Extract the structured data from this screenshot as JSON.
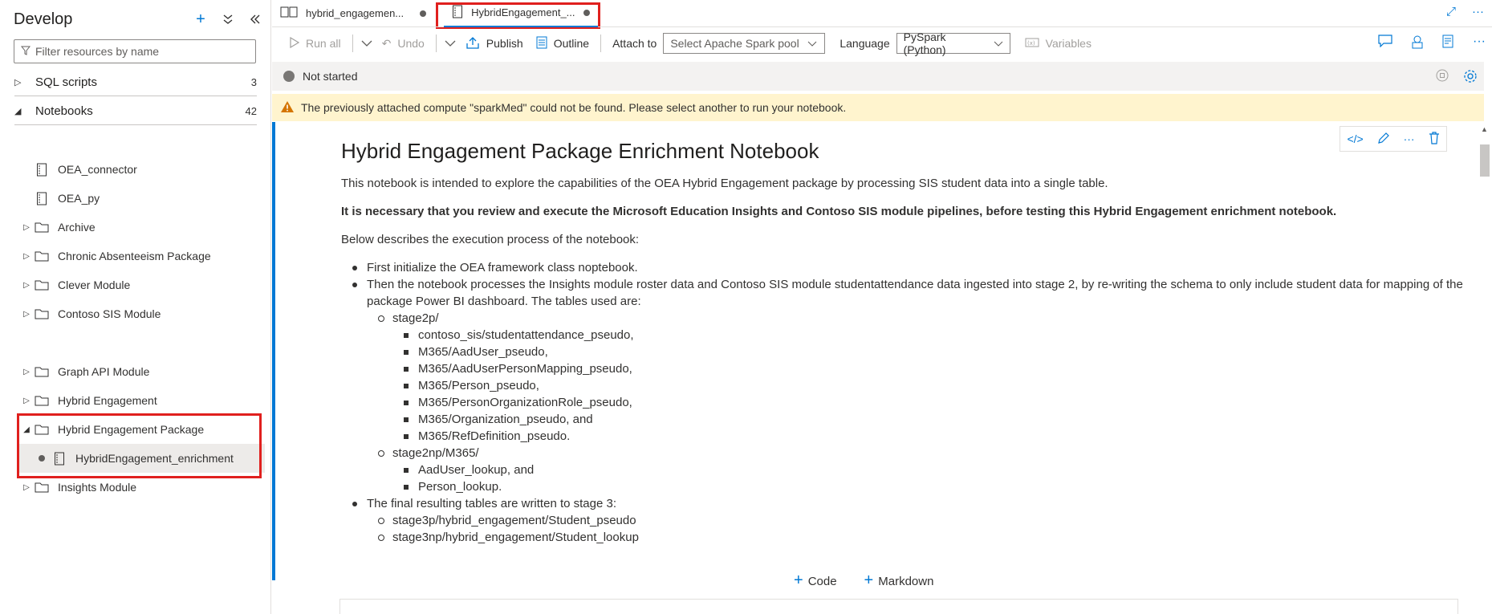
{
  "sidebar": {
    "title": "Develop",
    "filter_placeholder": "Filter resources by name",
    "sections": [
      {
        "label": "SQL scripts",
        "count": "3"
      },
      {
        "label": "Notebooks",
        "count": "42"
      }
    ],
    "items": {
      "oea_connector": "OEA_connector",
      "oea_py": "OEA_py",
      "archive": "Archive",
      "chronic": "Chronic Absenteeism Package",
      "clever": "Clever Module",
      "contoso": "Contoso SIS Module",
      "graph": "Graph API Module",
      "hybrid": "Hybrid Engagement",
      "hybrid_pkg": "Hybrid Engagement Package",
      "hybrid_notebook": "HybridEngagement_enrichment",
      "insights": "Insights Module"
    }
  },
  "tabs": [
    {
      "label": "hybrid_engagemen..."
    },
    {
      "label": "HybridEngagement_..."
    }
  ],
  "toolbar": {
    "run_all": "Run all",
    "undo": "Undo",
    "publish": "Publish",
    "outline": "Outline",
    "attach_to_label": "Attach to",
    "attach_to_value": "Select Apache Spark pool",
    "language_label": "Language",
    "language_value": "PySpark (Python)",
    "variables": "Variables"
  },
  "status": {
    "text": "Not started"
  },
  "warning": {
    "text": "The previously attached compute \"sparkMed\" could not be found. Please select another to run your notebook."
  },
  "notebook": {
    "title": "Hybrid Engagement Package Enrichment Notebook",
    "intro": "This notebook is intended to explore the capabilities of the OEA Hybrid Engagement package by processing SIS student data into a single table.",
    "note": "It is necessary that you review and execute the Microsoft Education Insights and Contoso SIS module pipelines, before testing this Hybrid Engagement enrichment notebook.",
    "process_intro": "Below describes the execution process of the notebook:",
    "step1": "First initialize the OEA framework class noptebook.",
    "step2": "Then the notebook processes the Insights module roster data and Contoso SIS module studentattendance data ingested into stage 2, by re-writing the schema to only include student data for mapping of the package Power BI dashboard. The tables used are:",
    "stage2p": "stage2p/",
    "stage2p_tables": [
      "contoso_sis/studentattendance_pseudo,",
      "M365/AadUser_pseudo,",
      "M365/AadUserPersonMapping_pseudo,",
      "M365/Person_pseudo,",
      "M365/PersonOrganizationRole_pseudo,",
      "M365/Organization_pseudo, and",
      "M365/RefDefinition_pseudo."
    ],
    "stage2np": "stage2np/M365/",
    "stage2np_tables": [
      "AadUser_lookup, and",
      "Person_lookup."
    ],
    "step3": "The final resulting tables are written to stage 3:",
    "stage3_tables": [
      "stage3p/hybrid_engagement/Student_pseudo",
      "stage3np/hybrid_engagement/Student_lookup"
    ]
  },
  "add_cell": {
    "code": "Code",
    "markdown": "Markdown"
  },
  "colors": {
    "accent": "#0078d4",
    "highlight": "#e0201e",
    "warning_bg": "#fff4ce"
  }
}
